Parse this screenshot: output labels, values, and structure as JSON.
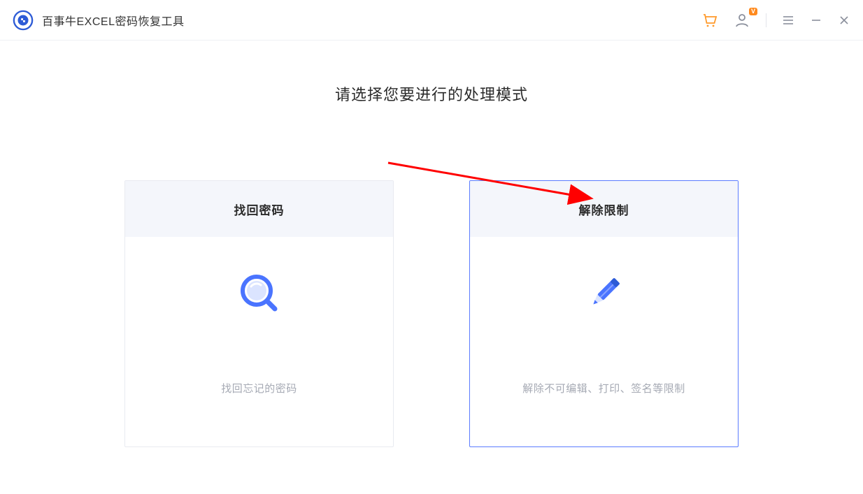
{
  "header": {
    "app_title": "百事牛EXCEL密码恢复工具",
    "vip_badge": "V",
    "cart_icon_color": "#ff9a2b",
    "account_icon_color": "#8a8f9c"
  },
  "main": {
    "heading": "请选择您要进行的处理模式",
    "cards": [
      {
        "title": "找回密码",
        "desc": "找回忘记的密码",
        "selected": false,
        "icon": "magnifier"
      },
      {
        "title": "解除限制",
        "desc": "解除不可编辑、打印、签名等限制",
        "selected": true,
        "icon": "pencil"
      }
    ]
  }
}
